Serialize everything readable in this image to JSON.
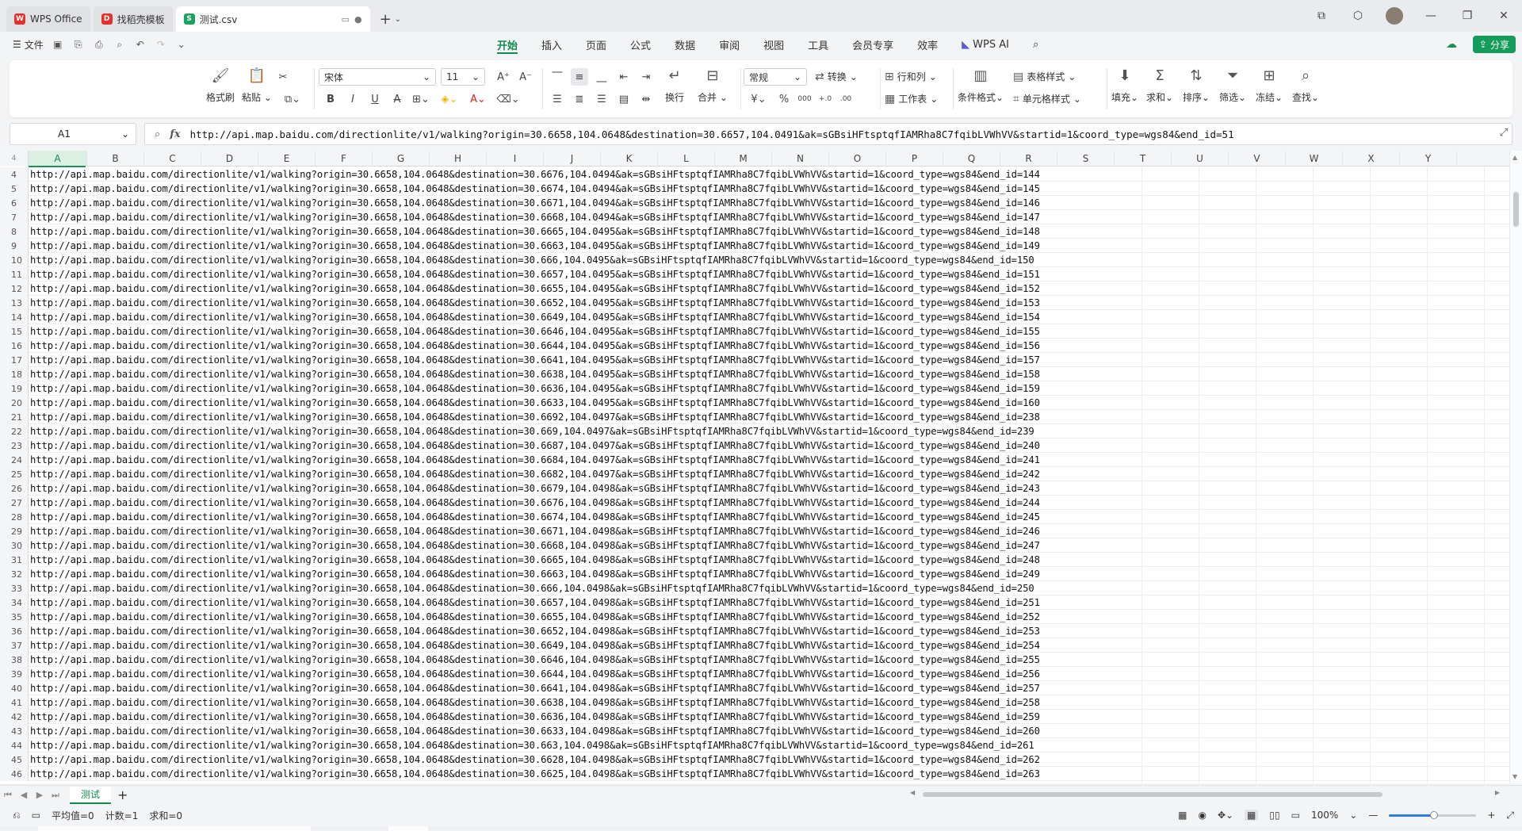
{
  "tabs": [
    {
      "label": "WPS Office",
      "icon": "wps-logo-icon",
      "color": "#e5312e"
    },
    {
      "label": "找稻壳模板",
      "icon": "docer-icon",
      "color": "#e5312e"
    },
    {
      "label": "测试.csv",
      "icon": "spreadsheet-s-icon",
      "color": "#1aa260"
    }
  ],
  "menu": {
    "file_label": "文件",
    "ribbon_tabs": [
      "开始",
      "插入",
      "页面",
      "公式",
      "数据",
      "审阅",
      "视图",
      "工具",
      "会员专享",
      "效率",
      "WPS AI"
    ],
    "active_tab": "开始",
    "share_label": "分享"
  },
  "ribbon": {
    "format_painter": "格式刷",
    "paste": "粘贴",
    "font_name": "宋体",
    "font_size": "11",
    "wrap": "换行",
    "merge": "合并",
    "number_format": "常规",
    "convert": "转换",
    "row_col": "行和列",
    "worksheet": "工作表",
    "cond_format": "条件格式",
    "table_style": "表格样式",
    "cell_style": "单元格样式",
    "fill": "填充",
    "sum": "求和",
    "sort": "排序",
    "filter": "筛选",
    "freeze": "冻结",
    "find": "查找",
    "currency_symbol": "¥",
    "percent_symbol": "%"
  },
  "formula_bar": {
    "cell_ref": "A1",
    "content": "http://api.map.baidu.com/directionlite/v1/walking?origin=30.6658,104.0648&destination=30.6657,104.0491&ak=sGBsiHFtsptqfIAMRha8C7fqibLVWhVV&startid=1&coord_type=wgs84&end_id=51"
  },
  "columns": [
    "A",
    "B",
    "C",
    "D",
    "E",
    "F",
    "G",
    "H",
    "I",
    "J",
    "K",
    "L",
    "M",
    "N",
    "O",
    "P",
    "Q",
    "R",
    "S",
    "T",
    "U",
    "V",
    "W",
    "X",
    "Y"
  ],
  "corner_label": "4",
  "rows": [
    {
      "n": "4",
      "v": "http://api.map.baidu.com/directionlite/v1/walking?origin=30.6658,104.0648&destination=30.6676,104.0494&ak=sGBsiHFtsptqfIAMRha8C7fqibLVWhVV&startid=1&coord_type=wgs84&end_id=144"
    },
    {
      "n": "5",
      "v": "http://api.map.baidu.com/directionlite/v1/walking?origin=30.6658,104.0648&destination=30.6674,104.0494&ak=sGBsiHFtsptqfIAMRha8C7fqibLVWhVV&startid=1&coord_type=wgs84&end_id=145"
    },
    {
      "n": "6",
      "v": "http://api.map.baidu.com/directionlite/v1/walking?origin=30.6658,104.0648&destination=30.6671,104.0494&ak=sGBsiHFtsptqfIAMRha8C7fqibLVWhVV&startid=1&coord_type=wgs84&end_id=146"
    },
    {
      "n": "7",
      "v": "http://api.map.baidu.com/directionlite/v1/walking?origin=30.6658,104.0648&destination=30.6668,104.0494&ak=sGBsiHFtsptqfIAMRha8C7fqibLVWhVV&startid=1&coord_type=wgs84&end_id=147"
    },
    {
      "n": "8",
      "v": "http://api.map.baidu.com/directionlite/v1/walking?origin=30.6658,104.0648&destination=30.6665,104.0495&ak=sGBsiHFtsptqfIAMRha8C7fqibLVWhVV&startid=1&coord_type=wgs84&end_id=148"
    },
    {
      "n": "9",
      "v": "http://api.map.baidu.com/directionlite/v1/walking?origin=30.6658,104.0648&destination=30.6663,104.0495&ak=sGBsiHFtsptqfIAMRha8C7fqibLVWhVV&startid=1&coord_type=wgs84&end_id=149"
    },
    {
      "n": "10",
      "v": "http://api.map.baidu.com/directionlite/v1/walking?origin=30.6658,104.0648&destination=30.666,104.0495&ak=sGBsiHFtsptqfIAMRha8C7fqibLVWhVV&startid=1&coord_type=wgs84&end_id=150"
    },
    {
      "n": "11",
      "v": "http://api.map.baidu.com/directionlite/v1/walking?origin=30.6658,104.0648&destination=30.6657,104.0495&ak=sGBsiHFtsptqfIAMRha8C7fqibLVWhVV&startid=1&coord_type=wgs84&end_id=151"
    },
    {
      "n": "12",
      "v": "http://api.map.baidu.com/directionlite/v1/walking?origin=30.6658,104.0648&destination=30.6655,104.0495&ak=sGBsiHFtsptqfIAMRha8C7fqibLVWhVV&startid=1&coord_type=wgs84&end_id=152"
    },
    {
      "n": "13",
      "v": "http://api.map.baidu.com/directionlite/v1/walking?origin=30.6658,104.0648&destination=30.6652,104.0495&ak=sGBsiHFtsptqfIAMRha8C7fqibLVWhVV&startid=1&coord_type=wgs84&end_id=153"
    },
    {
      "n": "14",
      "v": "http://api.map.baidu.com/directionlite/v1/walking?origin=30.6658,104.0648&destination=30.6649,104.0495&ak=sGBsiHFtsptqfIAMRha8C7fqibLVWhVV&startid=1&coord_type=wgs84&end_id=154"
    },
    {
      "n": "15",
      "v": "http://api.map.baidu.com/directionlite/v1/walking?origin=30.6658,104.0648&destination=30.6646,104.0495&ak=sGBsiHFtsptqfIAMRha8C7fqibLVWhVV&startid=1&coord_type=wgs84&end_id=155"
    },
    {
      "n": "16",
      "v": "http://api.map.baidu.com/directionlite/v1/walking?origin=30.6658,104.0648&destination=30.6644,104.0495&ak=sGBsiHFtsptqfIAMRha8C7fqibLVWhVV&startid=1&coord_type=wgs84&end_id=156"
    },
    {
      "n": "17",
      "v": "http://api.map.baidu.com/directionlite/v1/walking?origin=30.6658,104.0648&destination=30.6641,104.0495&ak=sGBsiHFtsptqfIAMRha8C7fqibLVWhVV&startid=1&coord_type=wgs84&end_id=157"
    },
    {
      "n": "18",
      "v": "http://api.map.baidu.com/directionlite/v1/walking?origin=30.6658,104.0648&destination=30.6638,104.0495&ak=sGBsiHFtsptqfIAMRha8C7fqibLVWhVV&startid=1&coord_type=wgs84&end_id=158"
    },
    {
      "n": "19",
      "v": "http://api.map.baidu.com/directionlite/v1/walking?origin=30.6658,104.0648&destination=30.6636,104.0495&ak=sGBsiHFtsptqfIAMRha8C7fqibLVWhVV&startid=1&coord_type=wgs84&end_id=159"
    },
    {
      "n": "20",
      "v": "http://api.map.baidu.com/directionlite/v1/walking?origin=30.6658,104.0648&destination=30.6633,104.0495&ak=sGBsiHFtsptqfIAMRha8C7fqibLVWhVV&startid=1&coord_type=wgs84&end_id=160"
    },
    {
      "n": "21",
      "v": "http://api.map.baidu.com/directionlite/v1/walking?origin=30.6658,104.0648&destination=30.6692,104.0497&ak=sGBsiHFtsptqfIAMRha8C7fqibLVWhVV&startid=1&coord_type=wgs84&end_id=238"
    },
    {
      "n": "22",
      "v": "http://api.map.baidu.com/directionlite/v1/walking?origin=30.6658,104.0648&destination=30.669,104.0497&ak=sGBsiHFtsptqfIAMRha8C7fqibLVWhVV&startid=1&coord_type=wgs84&end_id=239"
    },
    {
      "n": "23",
      "v": "http://api.map.baidu.com/directionlite/v1/walking?origin=30.6658,104.0648&destination=30.6687,104.0497&ak=sGBsiHFtsptqfIAMRha8C7fqibLVWhVV&startid=1&coord_type=wgs84&end_id=240"
    },
    {
      "n": "24",
      "v": "http://api.map.baidu.com/directionlite/v1/walking?origin=30.6658,104.0648&destination=30.6684,104.0497&ak=sGBsiHFtsptqfIAMRha8C7fqibLVWhVV&startid=1&coord_type=wgs84&end_id=241"
    },
    {
      "n": "25",
      "v": "http://api.map.baidu.com/directionlite/v1/walking?origin=30.6658,104.0648&destination=30.6682,104.0497&ak=sGBsiHFtsptqfIAMRha8C7fqibLVWhVV&startid=1&coord_type=wgs84&end_id=242"
    },
    {
      "n": "26",
      "v": "http://api.map.baidu.com/directionlite/v1/walking?origin=30.6658,104.0648&destination=30.6679,104.0498&ak=sGBsiHFtsptqfIAMRha8C7fqibLVWhVV&startid=1&coord_type=wgs84&end_id=243"
    },
    {
      "n": "27",
      "v": "http://api.map.baidu.com/directionlite/v1/walking?origin=30.6658,104.0648&destination=30.6676,104.0498&ak=sGBsiHFtsptqfIAMRha8C7fqibLVWhVV&startid=1&coord_type=wgs84&end_id=244"
    },
    {
      "n": "28",
      "v": "http://api.map.baidu.com/directionlite/v1/walking?origin=30.6658,104.0648&destination=30.6674,104.0498&ak=sGBsiHFtsptqfIAMRha8C7fqibLVWhVV&startid=1&coord_type=wgs84&end_id=245"
    },
    {
      "n": "29",
      "v": "http://api.map.baidu.com/directionlite/v1/walking?origin=30.6658,104.0648&destination=30.6671,104.0498&ak=sGBsiHFtsptqfIAMRha8C7fqibLVWhVV&startid=1&coord_type=wgs84&end_id=246"
    },
    {
      "n": "30",
      "v": "http://api.map.baidu.com/directionlite/v1/walking?origin=30.6658,104.0648&destination=30.6668,104.0498&ak=sGBsiHFtsptqfIAMRha8C7fqibLVWhVV&startid=1&coord_type=wgs84&end_id=247"
    },
    {
      "n": "31",
      "v": "http://api.map.baidu.com/directionlite/v1/walking?origin=30.6658,104.0648&destination=30.6665,104.0498&ak=sGBsiHFtsptqfIAMRha8C7fqibLVWhVV&startid=1&coord_type=wgs84&end_id=248"
    },
    {
      "n": "32",
      "v": "http://api.map.baidu.com/directionlite/v1/walking?origin=30.6658,104.0648&destination=30.6663,104.0498&ak=sGBsiHFtsptqfIAMRha8C7fqibLVWhVV&startid=1&coord_type=wgs84&end_id=249"
    },
    {
      "n": "33",
      "v": "http://api.map.baidu.com/directionlite/v1/walking?origin=30.6658,104.0648&destination=30.666,104.0498&ak=sGBsiHFtsptqfIAMRha8C7fqibLVWhVV&startid=1&coord_type=wgs84&end_id=250"
    },
    {
      "n": "34",
      "v": "http://api.map.baidu.com/directionlite/v1/walking?origin=30.6658,104.0648&destination=30.6657,104.0498&ak=sGBsiHFtsptqfIAMRha8C7fqibLVWhVV&startid=1&coord_type=wgs84&end_id=251"
    },
    {
      "n": "35",
      "v": "http://api.map.baidu.com/directionlite/v1/walking?origin=30.6658,104.0648&destination=30.6655,104.0498&ak=sGBsiHFtsptqfIAMRha8C7fqibLVWhVV&startid=1&coord_type=wgs84&end_id=252"
    },
    {
      "n": "36",
      "v": "http://api.map.baidu.com/directionlite/v1/walking?origin=30.6658,104.0648&destination=30.6652,104.0498&ak=sGBsiHFtsptqfIAMRha8C7fqibLVWhVV&startid=1&coord_type=wgs84&end_id=253"
    },
    {
      "n": "37",
      "v": "http://api.map.baidu.com/directionlite/v1/walking?origin=30.6658,104.0648&destination=30.6649,104.0498&ak=sGBsiHFtsptqfIAMRha8C7fqibLVWhVV&startid=1&coord_type=wgs84&end_id=254"
    },
    {
      "n": "38",
      "v": "http://api.map.baidu.com/directionlite/v1/walking?origin=30.6658,104.0648&destination=30.6646,104.0498&ak=sGBsiHFtsptqfIAMRha8C7fqibLVWhVV&startid=1&coord_type=wgs84&end_id=255"
    },
    {
      "n": "39",
      "v": "http://api.map.baidu.com/directionlite/v1/walking?origin=30.6658,104.0648&destination=30.6644,104.0498&ak=sGBsiHFtsptqfIAMRha8C7fqibLVWhVV&startid=1&coord_type=wgs84&end_id=256"
    },
    {
      "n": "40",
      "v": "http://api.map.baidu.com/directionlite/v1/walking?origin=30.6658,104.0648&destination=30.6641,104.0498&ak=sGBsiHFtsptqfIAMRha8C7fqibLVWhVV&startid=1&coord_type=wgs84&end_id=257"
    },
    {
      "n": "41",
      "v": "http://api.map.baidu.com/directionlite/v1/walking?origin=30.6658,104.0648&destination=30.6638,104.0498&ak=sGBsiHFtsptqfIAMRha8C7fqibLVWhVV&startid=1&coord_type=wgs84&end_id=258"
    },
    {
      "n": "42",
      "v": "http://api.map.baidu.com/directionlite/v1/walking?origin=30.6658,104.0648&destination=30.6636,104.0498&ak=sGBsiHFtsptqfIAMRha8C7fqibLVWhVV&startid=1&coord_type=wgs84&end_id=259"
    },
    {
      "n": "43",
      "v": "http://api.map.baidu.com/directionlite/v1/walking?origin=30.6658,104.0648&destination=30.6633,104.0498&ak=sGBsiHFtsptqfIAMRha8C7fqibLVWhVV&startid=1&coord_type=wgs84&end_id=260"
    },
    {
      "n": "44",
      "v": "http://api.map.baidu.com/directionlite/v1/walking?origin=30.6658,104.0648&destination=30.663,104.0498&ak=sGBsiHFtsptqfIAMRha8C7fqibLVWhVV&startid=1&coord_type=wgs84&end_id=261"
    },
    {
      "n": "45",
      "v": "http://api.map.baidu.com/directionlite/v1/walking?origin=30.6658,104.0648&destination=30.6628,104.0498&ak=sGBsiHFtsptqfIAMRha8C7fqibLVWhVV&startid=1&coord_type=wgs84&end_id=262"
    },
    {
      "n": "46",
      "v": "http://api.map.baidu.com/directionlite/v1/walking?origin=30.6658,104.0648&destination=30.6625,104.0498&ak=sGBsiHFtsptqfIAMRha8C7fqibLVWhVV&startid=1&coord_type=wgs84&end_id=263"
    }
  ],
  "sheet_tab": "测试",
  "status": {
    "average": "平均值=0",
    "count": "计数=1",
    "sum": "求和=0",
    "zoom": "100%"
  }
}
